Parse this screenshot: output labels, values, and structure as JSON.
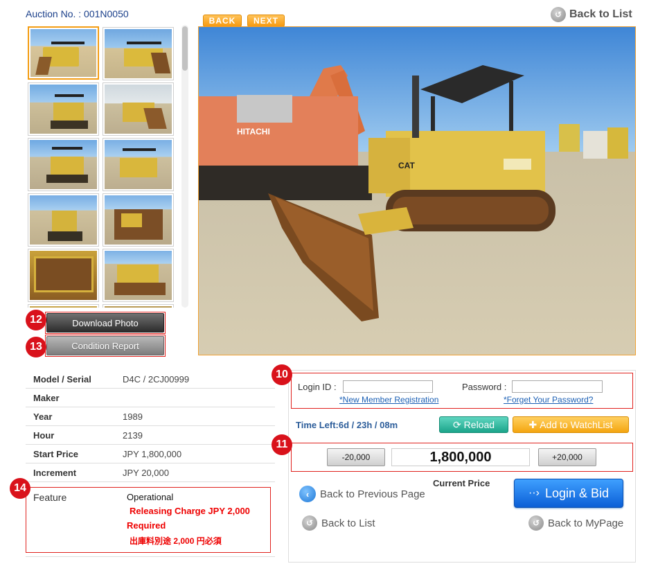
{
  "header": {
    "auction_no": "Auction No. : 001N0050",
    "back_label": "BACK",
    "next_label": "NEXT",
    "back_to_list": "Back to List"
  },
  "badges": {
    "download": "12",
    "condition": "13",
    "feature": "14",
    "login": "10",
    "bid": "11"
  },
  "actions": {
    "download_photo": "Download Photo",
    "condition_report": "Condition Report"
  },
  "specs": [
    {
      "label": "Model / Serial",
      "value": "D4C / 2CJ00999"
    },
    {
      "label": "Maker",
      "value": ""
    },
    {
      "label": "Year",
      "value": "1989"
    },
    {
      "label": "Hour",
      "value": "2139"
    },
    {
      "label": "Start Price",
      "value": "JPY 1,800,000"
    },
    {
      "label": "Increment",
      "value": "JPY 20,000"
    }
  ],
  "feature": {
    "label": "Feature",
    "status": "Operational",
    "note_en_1": "Releasing Charge JPY 2,000",
    "note_en_2": "Required",
    "note_jp": "出庫料別途 2,000 円必須"
  },
  "login": {
    "id_label": "Login ID :",
    "password_label": "Password :",
    "register_link": "*New Member Registration",
    "forgot_link": "*Forget Your Password?"
  },
  "bid": {
    "time_left": "Time Left:6d / 23h / 08m",
    "reload": "Reload",
    "watchlist": "Add to WatchList",
    "minus": "-20,000",
    "plus": "+20,000",
    "current_value": "1,800,000",
    "current_price_label": "Current Price",
    "login_bid": "Login & Bid"
  },
  "nav": {
    "back_previous": "Back to Previous Page",
    "back_to_list": "Back to List",
    "back_mypage": "Back to MyPage"
  },
  "colors": {
    "accent_orange": "#f39c12",
    "badge_red": "#d9121b",
    "link_blue": "#1a5fb4",
    "primary_blue": "#0b5fd6"
  }
}
